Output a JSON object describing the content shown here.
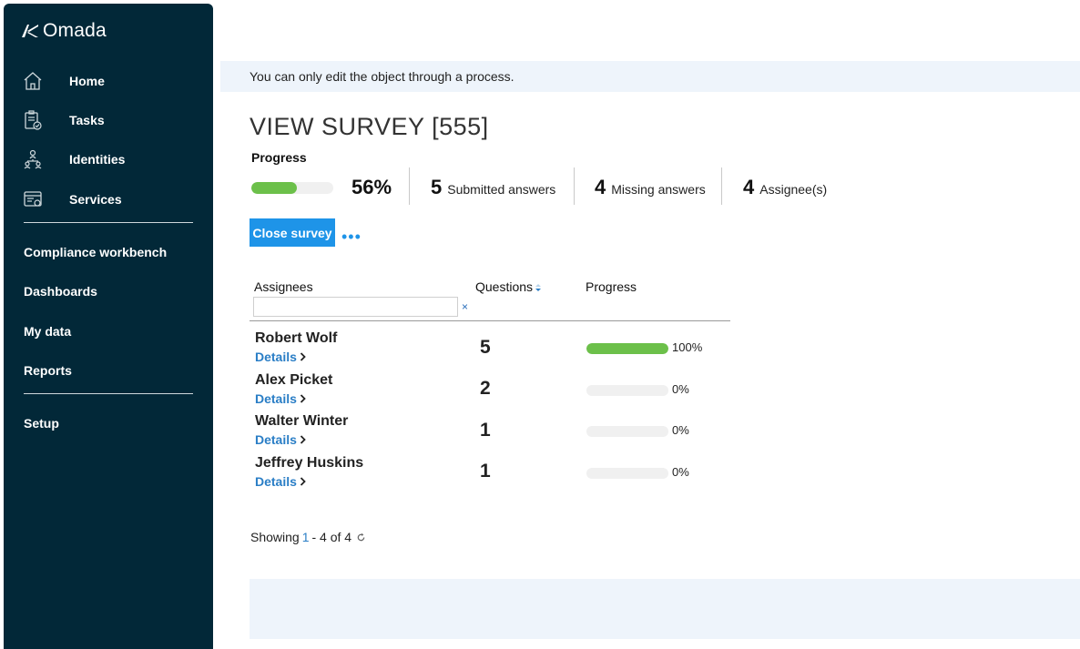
{
  "app": {
    "logo_text": "Omada"
  },
  "sidebar": {
    "main_items": [
      {
        "label": "Home",
        "icon": "home-icon"
      },
      {
        "label": "Tasks",
        "icon": "tasks-icon"
      },
      {
        "label": "Identities",
        "icon": "identities-icon"
      },
      {
        "label": "Services",
        "icon": "services-icon"
      }
    ],
    "secondary_items": [
      {
        "label": "Compliance workbench"
      },
      {
        "label": "Dashboards"
      },
      {
        "label": "My data"
      },
      {
        "label": "Reports"
      }
    ],
    "bottom_items": [
      {
        "label": "Setup"
      }
    ]
  },
  "banner": {
    "text": "You can only edit the object through a process."
  },
  "page": {
    "title": "VIEW SURVEY [555]",
    "progress_label": "Progress",
    "overall_progress": 56,
    "overall_progress_text": "56%",
    "stats": [
      {
        "value": "5",
        "label": "Submitted answers"
      },
      {
        "value": "4",
        "label": "Missing answers"
      },
      {
        "value": "4",
        "label": "Assignee(s)"
      }
    ],
    "close_button": "Close survey",
    "more_label": "•••"
  },
  "table": {
    "headers": {
      "assignees": "Assignees",
      "questions": "Questions",
      "progress": "Progress"
    },
    "filter": {
      "value": "",
      "placeholder": "",
      "clear": "×"
    },
    "details_label": "Details",
    "rows": [
      {
        "name": "Robert Wolf",
        "questions": "5",
        "progress": 100,
        "progress_text": "100%"
      },
      {
        "name": "Alex Picket",
        "questions": "2",
        "progress": 0,
        "progress_text": "0%"
      },
      {
        "name": "Walter Winter",
        "questions": "1",
        "progress": 0,
        "progress_text": "0%"
      },
      {
        "name": "Jeffrey Huskins",
        "questions": "1",
        "progress": 0,
        "progress_text": "0%"
      }
    ]
  },
  "pagination": {
    "prefix": "Showing",
    "start": "1",
    "suffix": "- 4 of 4"
  },
  "colors": {
    "sidebar_bg": "#022838",
    "accent": "#1e94e8",
    "progress_fill": "#6cc04a",
    "link": "#2a7ec6",
    "banner_bg": "#eef4fb"
  }
}
